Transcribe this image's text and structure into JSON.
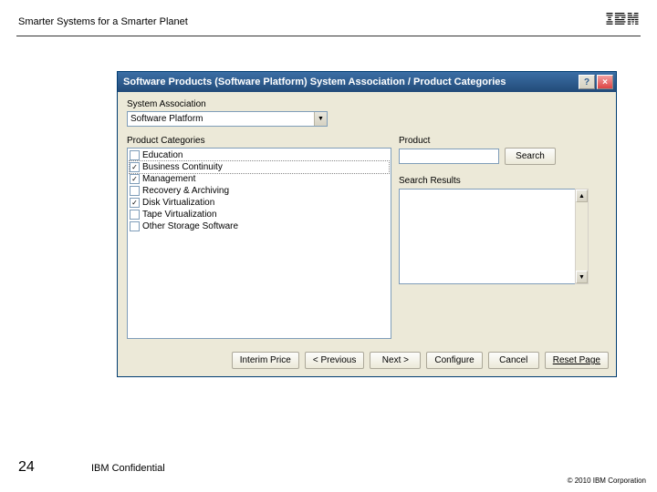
{
  "slide": {
    "header_title": "Smarter Systems for a Smarter Planet",
    "page_number": "24",
    "confidential": "IBM Confidential",
    "copyright": "© 2010 IBM Corporation"
  },
  "dialog": {
    "title": "Software Products (Software Platform)   System Association / Product Categories",
    "system_assoc_label": "System Association",
    "system_assoc_value": "Software Platform",
    "product_categories_label": "Product Categories",
    "categories": [
      {
        "label": "Education",
        "checked": false
      },
      {
        "label": "Business Continuity",
        "checked": true
      },
      {
        "label": "Management",
        "checked": true
      },
      {
        "label": "Recovery & Archiving",
        "checked": false
      },
      {
        "label": "Disk Virtualization",
        "checked": true
      },
      {
        "label": "Tape Virtualization",
        "checked": false
      },
      {
        "label": "Other Storage Software",
        "checked": false
      }
    ],
    "product_label": "Product",
    "search_btn": "Search",
    "search_results_label": "Search Results",
    "buttons": {
      "interim": "Interim Price",
      "previous": "< Previous",
      "next": "Next >",
      "configure": "Configure",
      "cancel": "Cancel",
      "reset": "Reset Page"
    }
  }
}
